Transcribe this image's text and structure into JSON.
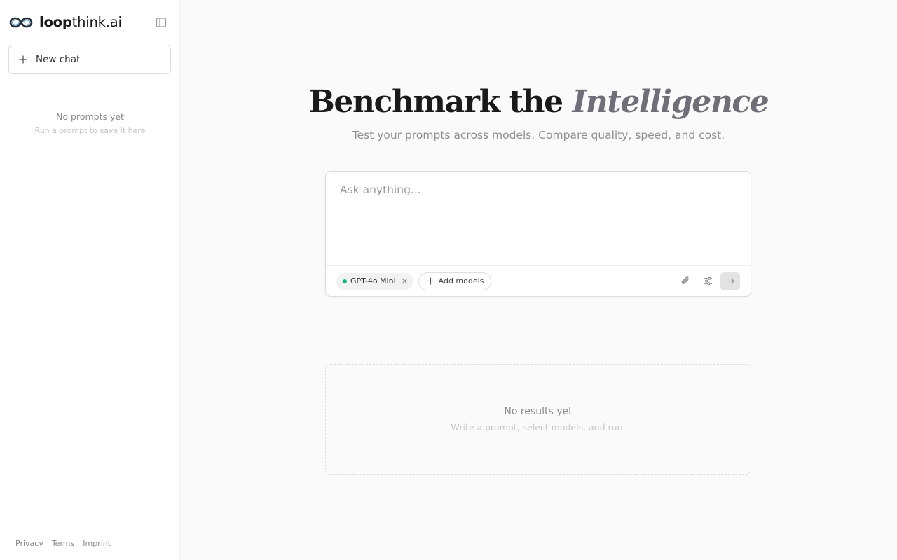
{
  "brand": {
    "name_bold": "loop",
    "name_light": "think.ai"
  },
  "sidebar": {
    "new_chat_label": "New chat",
    "empty_title": "No prompts yet",
    "empty_subtitle": "Run a prompt to save it here",
    "footer_links": [
      "Privacy",
      "Terms",
      "Imprint"
    ]
  },
  "hero": {
    "title_plain": "Benchmark the ",
    "title_accent": "Intelligence",
    "subtitle": "Test your prompts across models. Compare quality, speed, and cost."
  },
  "composer": {
    "placeholder": "Ask anything...",
    "value": "",
    "selected_models": [
      {
        "name": "GPT-4o Mini",
        "status_color": "#10b981"
      }
    ],
    "add_models_label": "Add models"
  },
  "results": {
    "empty_title": "No results yet",
    "empty_subtitle": "Write a prompt, select models, and run."
  },
  "colors": {
    "accent_dot": "#10b981",
    "hero_accent": "#6f6f78"
  },
  "icons": [
    "infinity-logo-icon",
    "sidebar-toggle-icon",
    "plus-icon",
    "close-icon",
    "paperclip-icon",
    "sliders-icon",
    "arrow-right-icon"
  ]
}
